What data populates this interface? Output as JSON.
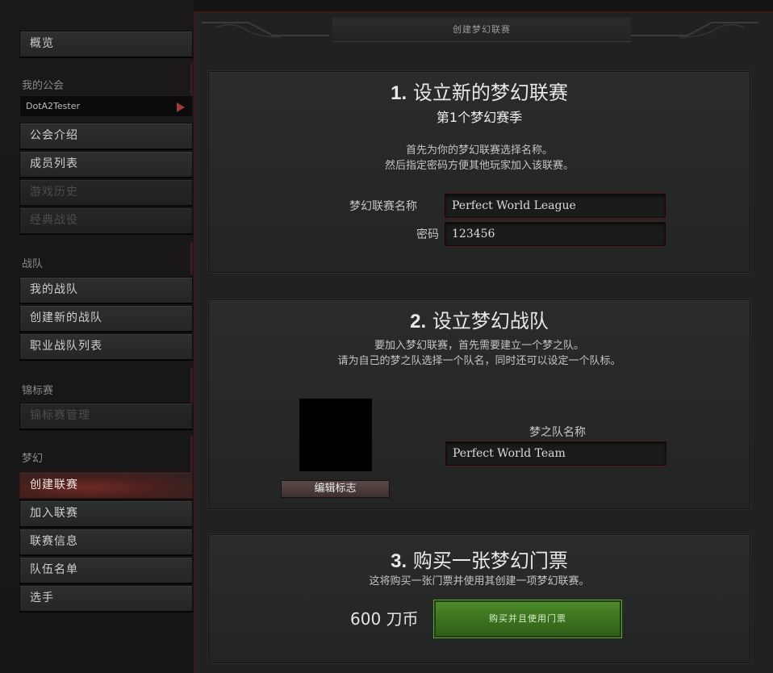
{
  "sidebar": {
    "overview": "概览",
    "my_guild_heading": "我的公会",
    "guild_name": "DotA2Tester",
    "guild_items": [
      "公会介绍",
      "成员列表",
      "游戏历史",
      "经典战役"
    ],
    "team_heading": "战队",
    "team_items": [
      "我的战队",
      "创建新的战队",
      "职业战队列表"
    ],
    "tournament_heading": "锦标赛",
    "tournament_items": [
      "锦标赛管理"
    ],
    "fantasy_heading": "梦幻",
    "fantasy_items": [
      "创建联赛",
      "加入联赛",
      "联赛信息",
      "队伍名单",
      "选手"
    ]
  },
  "main": {
    "header": "创建梦幻联赛",
    "section1": {
      "num": "1.",
      "title": "设立新的梦幻联赛",
      "subtitle": "第1个梦幻赛季",
      "desc_line1": "首先为你的梦幻联赛选择名称。",
      "desc_line2": "然后指定密码方便其他玩家加入该联赛。",
      "name_label": "梦幻联赛名称",
      "name_value": "Perfect World League",
      "password_label": "密码",
      "password_value": "123456"
    },
    "section2": {
      "num": "2.",
      "title": "设立梦幻战队",
      "desc_line1": "要加入梦幻联赛，首先需要建立一个梦之队。",
      "desc_line2": "请为自己的梦之队选择一个队名，同时还可以设定一个队标。",
      "edit_logo": "编辑标志",
      "team_name_label": "梦之队名称",
      "team_name_value": "Perfect World Team"
    },
    "section3": {
      "num": "3.",
      "title": "购买一张梦幻门票",
      "desc": "这将购买一张门票并使用其创建一项梦幻联赛。",
      "price": "600 刀币",
      "buy_button": "购买并且使用门票"
    }
  },
  "colors": {
    "accent_red": "#6d2a26",
    "buy_green": "#3c7320",
    "field_border": "#4a1c1c"
  }
}
